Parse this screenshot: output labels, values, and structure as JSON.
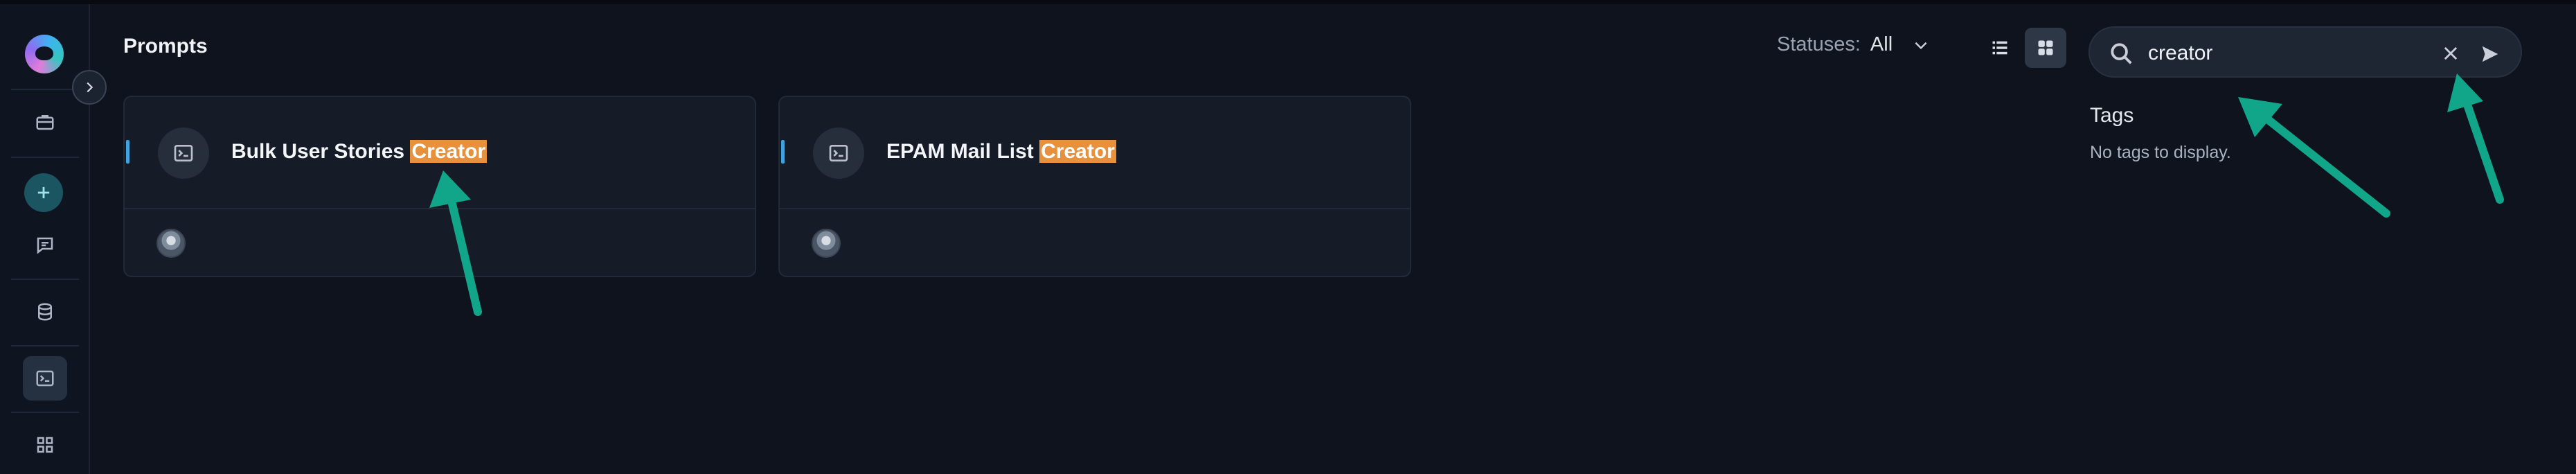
{
  "app": {
    "page_title": "Prompts"
  },
  "sidebar": {
    "items": [
      {
        "name": "briefcase"
      },
      {
        "name": "add"
      },
      {
        "name": "chat"
      },
      {
        "name": "database"
      },
      {
        "name": "prompts",
        "active": true
      },
      {
        "name": "apps"
      }
    ]
  },
  "filters": {
    "statuses_label": "Statuses:",
    "statuses_value": "All"
  },
  "search": {
    "value": "creator"
  },
  "tags": {
    "title": "Tags",
    "empty": "No tags to display."
  },
  "cards": [
    {
      "title_prefix": "Bulk User Stories ",
      "title_match": "Creator"
    },
    {
      "title_prefix": "EPAM Mail List ",
      "title_match": "Creator"
    }
  ],
  "colors": {
    "highlight": "#e8913d",
    "accent": "#3fa3e0",
    "annotation_arrow": "#11a68a"
  },
  "icons": [
    "logo",
    "chevron-right-icon",
    "briefcase-icon",
    "plus-icon",
    "chat-icon",
    "database-icon",
    "terminal-icon",
    "grid-icon",
    "chevron-down-icon",
    "list-icon",
    "search-icon",
    "close-icon",
    "send-icon",
    "avatar"
  ]
}
